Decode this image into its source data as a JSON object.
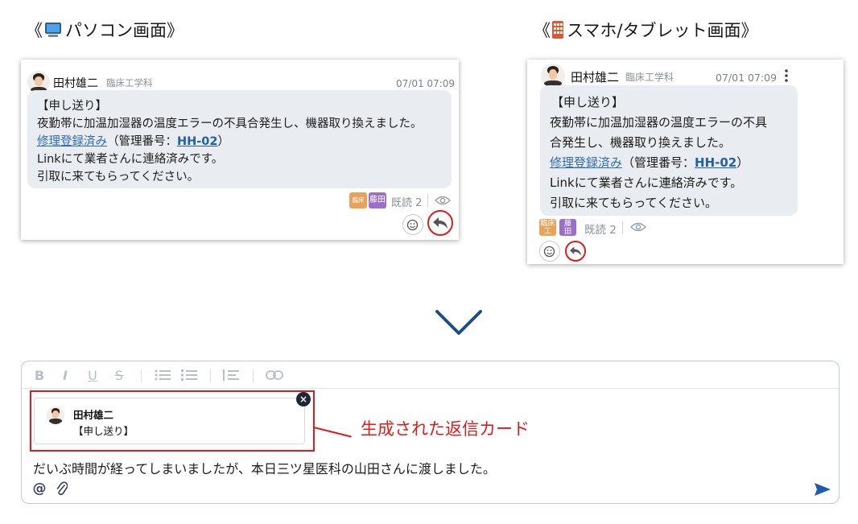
{
  "headings": {
    "pc": {
      "open": "《",
      "label": "パソコン画面",
      "close": "》",
      "icon": "computer-emoji-icon"
    },
    "mobile": {
      "open": "《",
      "label": "スマホ/タブレット画面",
      "close": "》",
      "icon": "mobile-phone-emoji-icon"
    }
  },
  "pc_card": {
    "sender_name": "田村雄二",
    "sender_dept": "臨床工学科",
    "timestamp": "07/01 07:09",
    "lines": {
      "l1": "【申し送り】",
      "l2": "夜勤帯に加温加湿器の温度エラーの不具合発生し、機器取り換えました。",
      "l3_link": "修理登録済み",
      "l3_mid": "（管理番号：",
      "l3_code": "HH-02",
      "l3_end": "）",
      "l4": "Linkにて業者さんに連絡済みです。",
      "l5": "引取に来てもらってください。"
    },
    "readers": [
      {
        "label": "臨床工",
        "color": "#e8a35a"
      },
      {
        "label": "藤田",
        "color": "#9b6fc9"
      }
    ],
    "read_label": "既読 2",
    "icons": {
      "seen": "eye-icon",
      "reaction": "emoji-add-icon",
      "reply": "reply-arrow-icon"
    }
  },
  "mobile_card": {
    "sender_name": "田村雄二",
    "sender_dept": "臨床工学科",
    "timestamp": "07/01 07:09",
    "lines": {
      "l1": "【申し送り】",
      "l2": "夜勤帯に加温加湿器の温度エラーの不具",
      "l3": "合発生し、機器取り換えました。",
      "l4_link": "修理登録済み",
      "l4_mid": "（管理番号：",
      "l4_code": "HH-02",
      "l4_end": "）",
      "l5": "Linkにて業者さんに連絡済みです。",
      "l6": "引取に来てもらってください。"
    },
    "readers": [
      {
        "line1": "臨床",
        "line2": "工",
        "color": "#e8a35a"
      },
      {
        "line1": "藤",
        "line2": "田",
        "color": "#9b6fc9"
      }
    ],
    "read_label": "既読 2",
    "icons": {
      "more": "more-vertical-icon",
      "seen": "eye-icon",
      "reaction": "emoji-add-icon",
      "reply": "reply-arrow-icon"
    }
  },
  "composer": {
    "toolbar": [
      "B",
      "I",
      "U",
      "S",
      "bullet-list-icon",
      "numbered-list-icon",
      "quote-icon",
      "link-icon"
    ],
    "reply_card": {
      "name": "田村雄二",
      "snippet": "【申し送り】"
    },
    "message": "だいぶ時間が経ってしまいましたが、本日三ツ星医科の山田さんに渡しました。",
    "icons": {
      "mention": "@",
      "attach": "paperclip-icon",
      "send": "send-icon",
      "close": "×"
    }
  },
  "callout": "生成された返信カード",
  "colors": {
    "highlight": "#e01b1b",
    "link": "#2f6db5",
    "chevron": "#1d4f86",
    "send": "#1e5bb0"
  }
}
